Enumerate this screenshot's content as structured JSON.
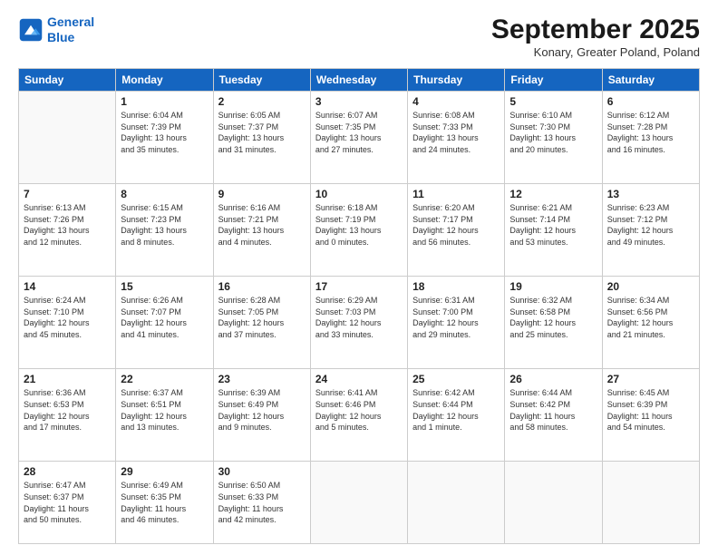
{
  "header": {
    "logo_line1": "General",
    "logo_line2": "Blue",
    "month": "September 2025",
    "location": "Konary, Greater Poland, Poland"
  },
  "weekdays": [
    "Sunday",
    "Monday",
    "Tuesday",
    "Wednesday",
    "Thursday",
    "Friday",
    "Saturday"
  ],
  "weeks": [
    [
      {
        "day": "",
        "info": ""
      },
      {
        "day": "1",
        "info": "Sunrise: 6:04 AM\nSunset: 7:39 PM\nDaylight: 13 hours\nand 35 minutes."
      },
      {
        "day": "2",
        "info": "Sunrise: 6:05 AM\nSunset: 7:37 PM\nDaylight: 13 hours\nand 31 minutes."
      },
      {
        "day": "3",
        "info": "Sunrise: 6:07 AM\nSunset: 7:35 PM\nDaylight: 13 hours\nand 27 minutes."
      },
      {
        "day": "4",
        "info": "Sunrise: 6:08 AM\nSunset: 7:33 PM\nDaylight: 13 hours\nand 24 minutes."
      },
      {
        "day": "5",
        "info": "Sunrise: 6:10 AM\nSunset: 7:30 PM\nDaylight: 13 hours\nand 20 minutes."
      },
      {
        "day": "6",
        "info": "Sunrise: 6:12 AM\nSunset: 7:28 PM\nDaylight: 13 hours\nand 16 minutes."
      }
    ],
    [
      {
        "day": "7",
        "info": "Sunrise: 6:13 AM\nSunset: 7:26 PM\nDaylight: 13 hours\nand 12 minutes."
      },
      {
        "day": "8",
        "info": "Sunrise: 6:15 AM\nSunset: 7:23 PM\nDaylight: 13 hours\nand 8 minutes."
      },
      {
        "day": "9",
        "info": "Sunrise: 6:16 AM\nSunset: 7:21 PM\nDaylight: 13 hours\nand 4 minutes."
      },
      {
        "day": "10",
        "info": "Sunrise: 6:18 AM\nSunset: 7:19 PM\nDaylight: 13 hours\nand 0 minutes."
      },
      {
        "day": "11",
        "info": "Sunrise: 6:20 AM\nSunset: 7:17 PM\nDaylight: 12 hours\nand 56 minutes."
      },
      {
        "day": "12",
        "info": "Sunrise: 6:21 AM\nSunset: 7:14 PM\nDaylight: 12 hours\nand 53 minutes."
      },
      {
        "day": "13",
        "info": "Sunrise: 6:23 AM\nSunset: 7:12 PM\nDaylight: 12 hours\nand 49 minutes."
      }
    ],
    [
      {
        "day": "14",
        "info": "Sunrise: 6:24 AM\nSunset: 7:10 PM\nDaylight: 12 hours\nand 45 minutes."
      },
      {
        "day": "15",
        "info": "Sunrise: 6:26 AM\nSunset: 7:07 PM\nDaylight: 12 hours\nand 41 minutes."
      },
      {
        "day": "16",
        "info": "Sunrise: 6:28 AM\nSunset: 7:05 PM\nDaylight: 12 hours\nand 37 minutes."
      },
      {
        "day": "17",
        "info": "Sunrise: 6:29 AM\nSunset: 7:03 PM\nDaylight: 12 hours\nand 33 minutes."
      },
      {
        "day": "18",
        "info": "Sunrise: 6:31 AM\nSunset: 7:00 PM\nDaylight: 12 hours\nand 29 minutes."
      },
      {
        "day": "19",
        "info": "Sunrise: 6:32 AM\nSunset: 6:58 PM\nDaylight: 12 hours\nand 25 minutes."
      },
      {
        "day": "20",
        "info": "Sunrise: 6:34 AM\nSunset: 6:56 PM\nDaylight: 12 hours\nand 21 minutes."
      }
    ],
    [
      {
        "day": "21",
        "info": "Sunrise: 6:36 AM\nSunset: 6:53 PM\nDaylight: 12 hours\nand 17 minutes."
      },
      {
        "day": "22",
        "info": "Sunrise: 6:37 AM\nSunset: 6:51 PM\nDaylight: 12 hours\nand 13 minutes."
      },
      {
        "day": "23",
        "info": "Sunrise: 6:39 AM\nSunset: 6:49 PM\nDaylight: 12 hours\nand 9 minutes."
      },
      {
        "day": "24",
        "info": "Sunrise: 6:41 AM\nSunset: 6:46 PM\nDaylight: 12 hours\nand 5 minutes."
      },
      {
        "day": "25",
        "info": "Sunrise: 6:42 AM\nSunset: 6:44 PM\nDaylight: 12 hours\nand 1 minute."
      },
      {
        "day": "26",
        "info": "Sunrise: 6:44 AM\nSunset: 6:42 PM\nDaylight: 11 hours\nand 58 minutes."
      },
      {
        "day": "27",
        "info": "Sunrise: 6:45 AM\nSunset: 6:39 PM\nDaylight: 11 hours\nand 54 minutes."
      }
    ],
    [
      {
        "day": "28",
        "info": "Sunrise: 6:47 AM\nSunset: 6:37 PM\nDaylight: 11 hours\nand 50 minutes."
      },
      {
        "day": "29",
        "info": "Sunrise: 6:49 AM\nSunset: 6:35 PM\nDaylight: 11 hours\nand 46 minutes."
      },
      {
        "day": "30",
        "info": "Sunrise: 6:50 AM\nSunset: 6:33 PM\nDaylight: 11 hours\nand 42 minutes."
      },
      {
        "day": "",
        "info": ""
      },
      {
        "day": "",
        "info": ""
      },
      {
        "day": "",
        "info": ""
      },
      {
        "day": "",
        "info": ""
      }
    ]
  ]
}
